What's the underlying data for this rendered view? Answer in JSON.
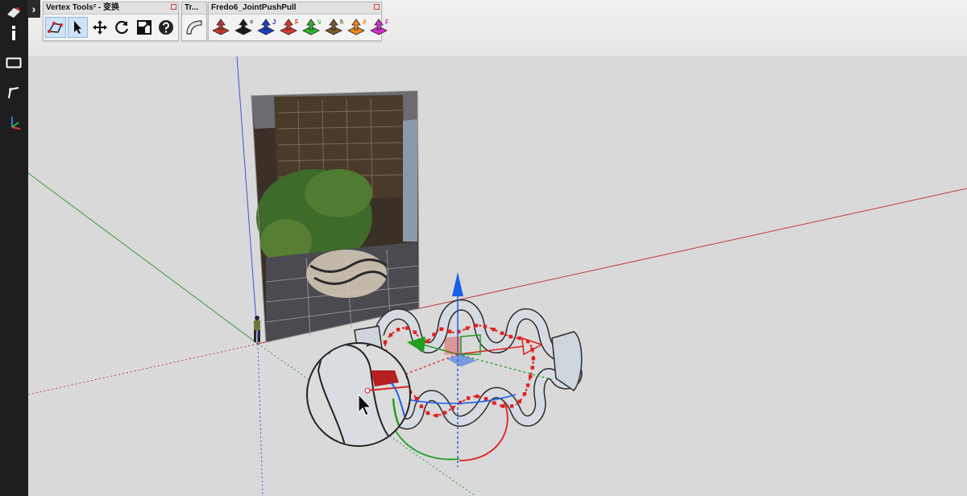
{
  "toolbars": {
    "vertex_tools": {
      "title": "Vertex Tools² - 变换",
      "buttons": [
        "select-polygon-icon",
        "select-arrow-icon",
        "move-icon",
        "rotate-icon",
        "scale-icon",
        "help-icon"
      ]
    },
    "tr": {
      "title": "Tr...",
      "buttons": [
        "curve-deform-icon"
      ]
    },
    "joint_push_pull": {
      "title": "Fredo6_JointPushPull",
      "buttons": [
        {
          "icon": "joint-push-pull-icon",
          "letter": "",
          "color": "#c0392b"
        },
        {
          "icon": "vector-push-pull-icon",
          "letter": "=",
          "color": "#1a1a1a"
        },
        {
          "icon": "joint-push-pull-blue-icon",
          "letter": "J",
          "color": "#1f3fc4"
        },
        {
          "icon": "normal-push-pull-icon",
          "letter": "R",
          "color": "#d93a2b"
        },
        {
          "icon": "volume-push-pull-icon",
          "letter": "V",
          "color": "#2eb82e"
        },
        {
          "icon": "normal-extrude-icon",
          "letter": "N",
          "color": "#7a5a2e"
        },
        {
          "icon": "extrude-x-icon",
          "letter": "X",
          "color": "#f08a1c"
        },
        {
          "icon": "extrude-f-icon",
          "letter": "F",
          "color": "#d92fd0"
        }
      ]
    }
  },
  "sidebar": {
    "items": [
      "sketchup-logo-icon",
      "info-icon",
      "rectangle-icon",
      "line-tool-icon",
      "axes-icon"
    ],
    "expand_label": "›"
  },
  "scene": {
    "axis_colors": {
      "red": "#c83c3c",
      "green": "#3a9a3a",
      "blue": "#3b55d6"
    },
    "gizmo_colors": {
      "points": "#e02020",
      "x": "#e02020",
      "y": "#20a020",
      "z": "#1a5fe8"
    }
  }
}
